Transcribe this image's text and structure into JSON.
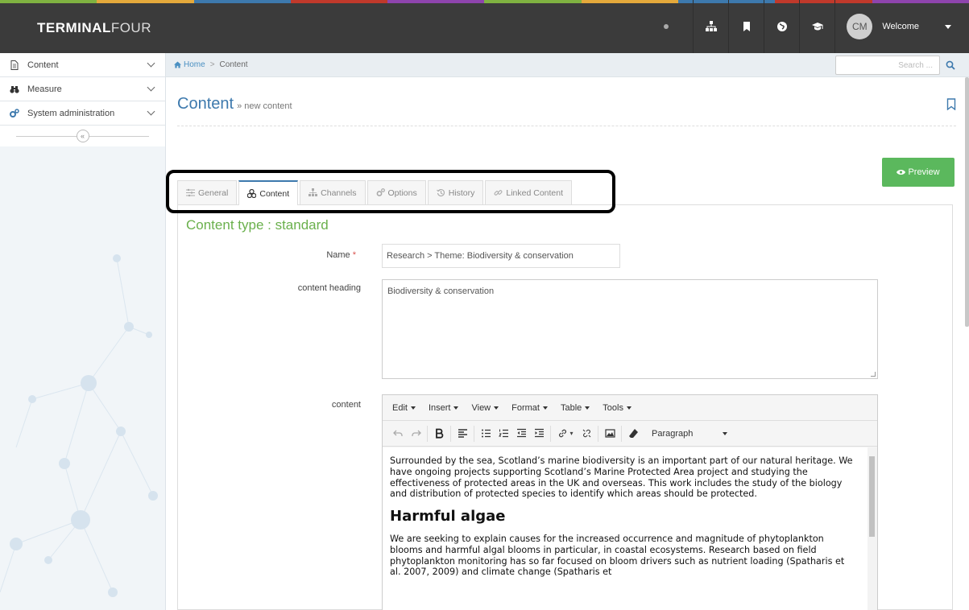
{
  "brand": {
    "bold": "TERMINAL",
    "thin": "FOUR"
  },
  "user": {
    "initials": "CM",
    "welcome": "Welcome"
  },
  "sidebar": {
    "items": [
      {
        "label": "Content",
        "icon": "document-icon"
      },
      {
        "label": "Measure",
        "icon": "binoculars-icon"
      },
      {
        "label": "System administration",
        "icon": "gears-icon"
      }
    ],
    "collapse_label": "«"
  },
  "breadcrumb": {
    "home": "Home",
    "separator": ">",
    "current": "Content"
  },
  "search": {
    "placeholder": "Search ..."
  },
  "page": {
    "title": "Content",
    "subtitle": "» new content"
  },
  "preview_label": "Preview",
  "tabs": [
    {
      "label": "General",
      "icon": "sliders-icon"
    },
    {
      "label": "Content",
      "icon": "content-icon"
    },
    {
      "label": "Channels",
      "icon": "sitemap-icon"
    },
    {
      "label": "Options",
      "icon": "gears-icon"
    },
    {
      "label": "History",
      "icon": "history-icon"
    },
    {
      "label": "Linked Content",
      "icon": "link-icon"
    }
  ],
  "content_type": "Content type : standard",
  "fields": {
    "name_label": "Name",
    "name_required": "*",
    "name_value": "Research > Theme: Biodiversity & conservation",
    "heading_label": "content heading",
    "heading_value": "Biodiversity & conservation",
    "content_label": "content"
  },
  "editor": {
    "menus": [
      "Edit",
      "Insert",
      "View",
      "Format",
      "Table",
      "Tools"
    ],
    "format_select": "Paragraph",
    "paragraph1": "Surrounded by the sea, Scotland’s marine biodiversity is an important part of our natural heritage.  We have ongoing projects supporting Scotland’s Marine Protected Area project and studying the effectiveness of protected areas in the UK and overseas. This work includes the study of the biology and distribution of protected species to identify which areas should be protected.",
    "heading2": "Harmful algae",
    "paragraph2": "We are seeking to explain causes for the increased occurrence and magnitude of phytoplankton blooms and harmful algal blooms in particular, in coastal ecosystems. Research based on field phytoplankton monitoring has so far focused on bloom drivers such as nutrient loading (Spatharis et al. 2007, 2009) and climate change (Spatharis et"
  },
  "colors": {
    "topbar": "#3b3b3b",
    "accent_blue": "#3d79ad",
    "content_type_green": "#6ab04c",
    "preview_green": "#5bb85d"
  }
}
